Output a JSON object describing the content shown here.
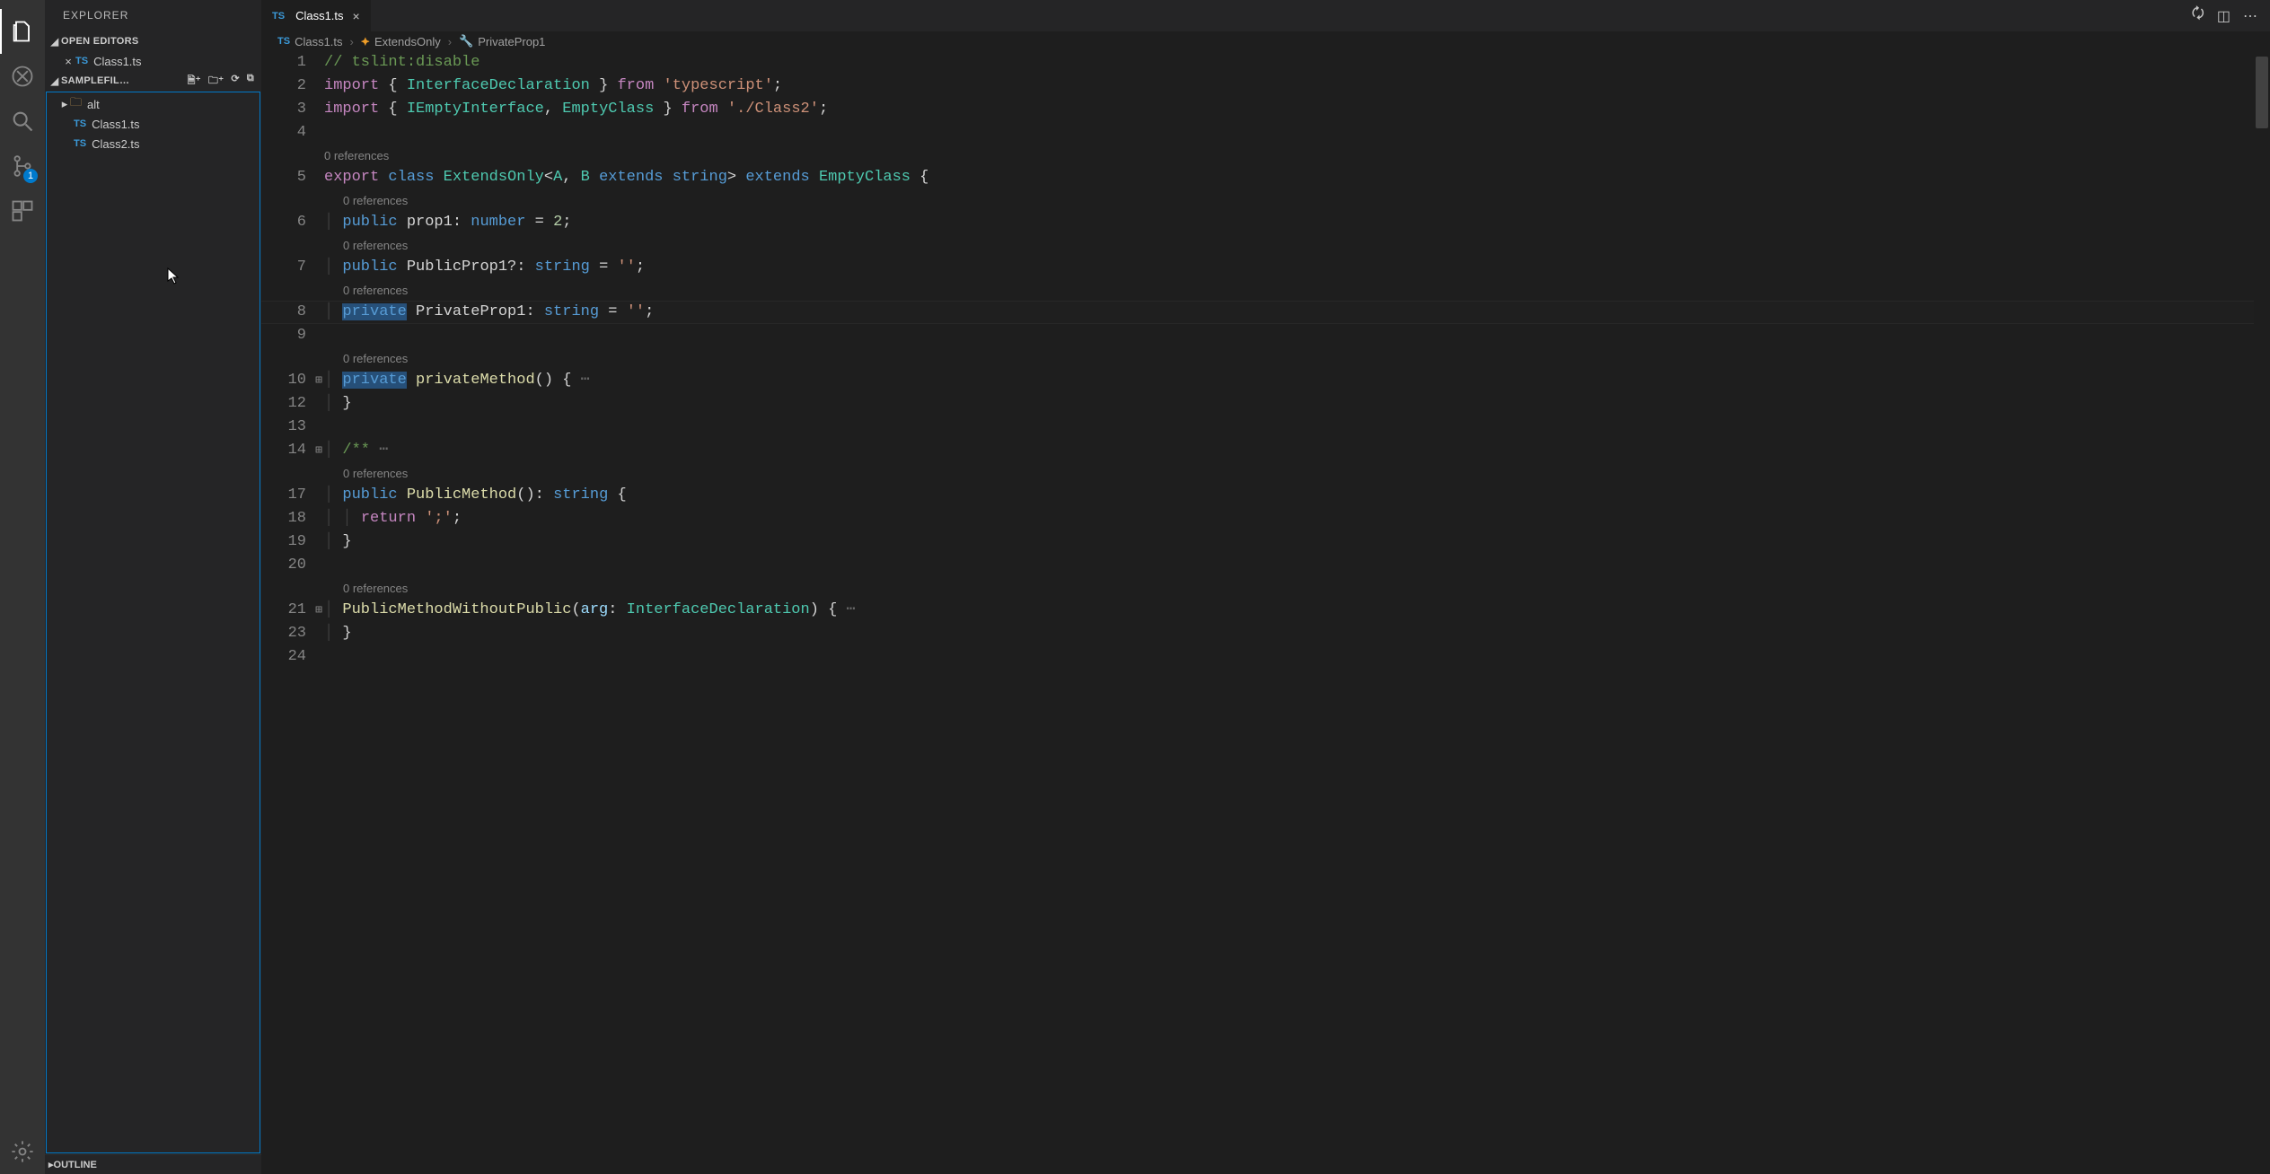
{
  "activity": {
    "items": [
      "files",
      "debug",
      "search",
      "scm",
      "extensions"
    ],
    "scm_badge": "1"
  },
  "sidebar": {
    "title": "EXPLORER",
    "open_editors_label": "OPEN EDITORS",
    "open_editors": [
      {
        "icon": "TS",
        "name": "Class1.ts"
      }
    ],
    "section_label": "SAMPLEFIL…",
    "tree": [
      {
        "type": "folder",
        "name": "alt",
        "expanded": false
      },
      {
        "type": "file",
        "icon": "TS",
        "name": "Class1.ts"
      },
      {
        "type": "file",
        "icon": "TS",
        "name": "Class2.ts"
      }
    ],
    "outline_label": "OUTLINE"
  },
  "tabs": {
    "open": [
      {
        "icon": "TS",
        "name": "Class1.ts",
        "dirty": false
      }
    ]
  },
  "breadcrumbs": {
    "items": [
      {
        "icon": "TS",
        "label": "Class1.ts"
      },
      {
        "icon": "class",
        "label": "ExtendsOnly"
      },
      {
        "icon": "prop",
        "label": "PrivateProp1"
      }
    ]
  },
  "codelens_label": "0 references",
  "editor": {
    "active_line_number": "8",
    "lines": [
      {
        "num": "1",
        "tokens": [
          [
            "c",
            "// tslint:disable"
          ]
        ]
      },
      {
        "num": "2",
        "tokens": [
          [
            "k2",
            "import"
          ],
          [
            "",
            " { "
          ],
          [
            "t",
            "InterfaceDeclaration"
          ],
          [
            "",
            " } "
          ],
          [
            "k2",
            "from"
          ],
          [
            "",
            " "
          ],
          [
            "s",
            "'typescript'"
          ],
          [
            "",
            ";"
          ]
        ]
      },
      {
        "num": "3",
        "tokens": [
          [
            "k2",
            "import"
          ],
          [
            "",
            " { "
          ],
          [
            "t",
            "IEmptyInterface"
          ],
          [
            "",
            ", "
          ],
          [
            "t",
            "EmptyClass"
          ],
          [
            "",
            " } "
          ],
          [
            "k2",
            "from"
          ],
          [
            "",
            " "
          ],
          [
            "s",
            "'./Class2'"
          ],
          [
            "",
            ";"
          ]
        ]
      },
      {
        "num": "4",
        "tokens": [
          [
            "",
            ""
          ]
        ]
      },
      {
        "codelens": true,
        "indent": 0
      },
      {
        "num": "5",
        "tokens": [
          [
            "k2",
            "export"
          ],
          [
            "",
            " "
          ],
          [
            "k",
            "class"
          ],
          [
            "",
            " "
          ],
          [
            "t",
            "ExtendsOnly"
          ],
          [
            "",
            "<"
          ],
          [
            "t",
            "A"
          ],
          [
            "",
            ", "
          ],
          [
            "t",
            "B"
          ],
          [
            "",
            " "
          ],
          [
            "k",
            "extends"
          ],
          [
            "",
            " "
          ],
          [
            "k",
            "string"
          ],
          [
            "",
            "> "
          ],
          [
            "k",
            "extends"
          ],
          [
            "",
            " "
          ],
          [
            "t",
            "EmptyClass"
          ],
          [
            "",
            " {"
          ]
        ]
      },
      {
        "codelens": true,
        "indent": 1
      },
      {
        "num": "6",
        "tokens": [
          [
            "",
            "  "
          ],
          [
            "k",
            "public"
          ],
          [
            "",
            " prop1: "
          ],
          [
            "k",
            "number"
          ],
          [
            "",
            " = "
          ],
          [
            "n",
            "2"
          ],
          [
            "",
            ";"
          ]
        ]
      },
      {
        "codelens": true,
        "indent": 1
      },
      {
        "num": "7",
        "tokens": [
          [
            "",
            "  "
          ],
          [
            "k",
            "public"
          ],
          [
            "",
            " PublicProp1?: "
          ],
          [
            "k",
            "string"
          ],
          [
            "",
            " = "
          ],
          [
            "s",
            "''"
          ],
          [
            "",
            ";"
          ]
        ]
      },
      {
        "codelens": true,
        "indent": 1
      },
      {
        "num": "8",
        "active": true,
        "tokens": [
          [
            "",
            "  "
          ],
          [
            "selk",
            "private"
          ],
          [
            "",
            " PrivateProp1: "
          ],
          [
            "k",
            "string"
          ],
          [
            "",
            " = "
          ],
          [
            "s",
            "''"
          ],
          [
            "",
            ";"
          ]
        ]
      },
      {
        "num": "9",
        "tokens": [
          [
            "",
            ""
          ]
        ]
      },
      {
        "codelens": true,
        "indent": 1
      },
      {
        "num": "10",
        "fold": true,
        "tokens": [
          [
            "",
            "  "
          ],
          [
            "selk",
            "private"
          ],
          [
            "",
            " "
          ],
          [
            "fn",
            "privateMethod"
          ],
          [
            "",
            "() { "
          ],
          [
            "fold-dots",
            "⋯"
          ]
        ]
      },
      {
        "num": "12",
        "tokens": [
          [
            "",
            "  }"
          ]
        ]
      },
      {
        "num": "13",
        "tokens": [
          [
            "",
            ""
          ]
        ]
      },
      {
        "num": "14",
        "fold": true,
        "tokens": [
          [
            "",
            "  "
          ],
          [
            "c",
            "/**"
          ],
          [
            "",
            " "
          ],
          [
            "fold-dots",
            "⋯"
          ]
        ]
      },
      {
        "codelens": true,
        "indent": 1
      },
      {
        "num": "17",
        "tokens": [
          [
            "",
            "  "
          ],
          [
            "k",
            "public"
          ],
          [
            "",
            " "
          ],
          [
            "fn",
            "PublicMethod"
          ],
          [
            "",
            "(): "
          ],
          [
            "k",
            "string"
          ],
          [
            "",
            " {"
          ]
        ]
      },
      {
        "num": "18",
        "tokens": [
          [
            "",
            "    "
          ],
          [
            "k2",
            "return"
          ],
          [
            "",
            " "
          ],
          [
            "s",
            "';'"
          ],
          [
            "",
            ";"
          ]
        ]
      },
      {
        "num": "19",
        "tokens": [
          [
            "",
            "  }"
          ]
        ]
      },
      {
        "num": "20",
        "tokens": [
          [
            "",
            ""
          ]
        ]
      },
      {
        "codelens": true,
        "indent": 1
      },
      {
        "num": "21",
        "fold": true,
        "tokens": [
          [
            "",
            "  "
          ],
          [
            "fn",
            "PublicMethodWithoutPublic"
          ],
          [
            "",
            "("
          ],
          [
            "p",
            "arg"
          ],
          [
            "",
            ": "
          ],
          [
            "t",
            "InterfaceDeclaration"
          ],
          [
            "",
            ") { "
          ],
          [
            "fold-dots",
            "⋯"
          ]
        ]
      },
      {
        "num": "23",
        "tokens": [
          [
            "",
            "  }"
          ]
        ]
      },
      {
        "num": "24",
        "tokens": [
          [
            "",
            ""
          ]
        ]
      }
    ]
  }
}
